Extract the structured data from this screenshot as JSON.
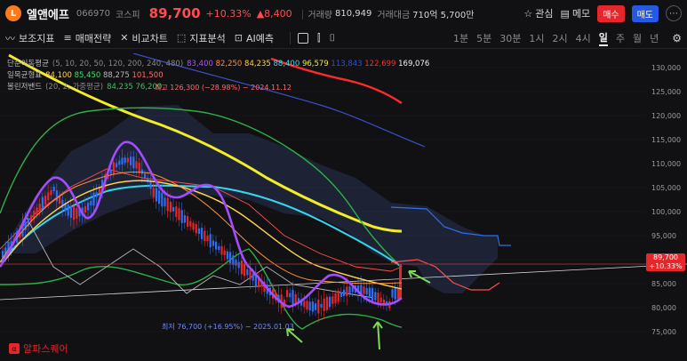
{
  "header": {
    "logo_letter": "L",
    "name": "엘앤에프",
    "code": "066970",
    "market": "코스피",
    "price": "89,700",
    "change_pct": "+10.33%",
    "change_amt": "▲8,400",
    "volume_label": "거래량",
    "volume": "810,949",
    "amount_label": "거래대금",
    "amount": "710억 5,700만",
    "watch_label": "관심",
    "memo_label": "메모",
    "buy_label": "매수",
    "sell_label": "매도"
  },
  "toolbar": {
    "tools": [
      "보조지표",
      "매매전략",
      "비교차트",
      "지표분석",
      "AI예측"
    ],
    "periods": [
      "1분",
      "5분",
      "30분",
      "1시",
      "2시",
      "4시",
      "일",
      "주",
      "월",
      "년"
    ],
    "active_period": "일"
  },
  "legend": {
    "ma": {
      "label": "단순이동평균",
      "params": "(5, 10, 20, 50, 120, 200, 240, 480)",
      "values": [
        "83,400",
        "82,250",
        "84,235",
        "88,400",
        "96,579",
        "113,843",
        "122,699",
        "169,076"
      ],
      "colors": [
        "#b052ff",
        "#ff8f3a",
        "#ffd34d",
        "#37d6ee",
        "#f2ec2a",
        "#3a4fc8",
        "#ff2b2b",
        "#f2f2f4"
      ]
    },
    "ichimoku": {
      "label": "일목균형표",
      "values": [
        "84,100",
        "85,450",
        "88,275",
        "101,500"
      ],
      "colors": [
        "#ffd34d",
        "#42e06b",
        "#b7b7bd",
        "#ff6b6b"
      ]
    },
    "bollinger": {
      "label": "볼린저밴드",
      "params": "(20, 2, 가중평균)",
      "values": [
        "84,235",
        "76,200"
      ],
      "colors": [
        "#42c05b",
        "#42c05b"
      ]
    }
  },
  "annotations": {
    "high": "최고 126,300 (−28.98%) − 2024.11.12",
    "low": "최저 76,700 (+16.95%) − 2025.01.03"
  },
  "price_tag": {
    "price": "89,700",
    "pct": "+10.33%"
  },
  "y_axis": [
    "130,000",
    "125,000",
    "120,000",
    "115,000",
    "110,000",
    "105,000",
    "100,000",
    "95,000",
    "90,000",
    "85,000",
    "80,000",
    "75,000"
  ],
  "brand": {
    "mark": "α",
    "name": "알파스퀘어"
  },
  "colors": {
    "up": "#e5262b",
    "down": "#2f6df2",
    "accent": "#ff7a1a"
  }
}
